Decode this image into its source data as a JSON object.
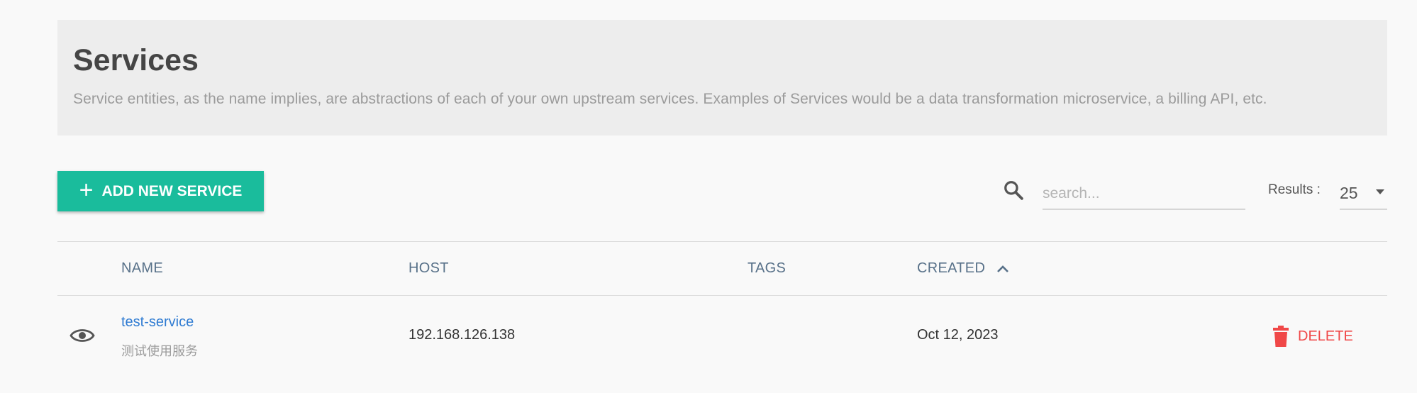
{
  "header": {
    "title": "Services",
    "description": "Service entities, as the name implies, are abstractions of each of your own upstream services. Examples of Services would be a data transformation microservice, a billing API, etc."
  },
  "toolbar": {
    "add_button_icon": "plus-icon",
    "add_button_label": "ADD NEW SERVICE",
    "search_icon": "search-icon",
    "search_placeholder": "search...",
    "search_value": "",
    "results_label": "Results :",
    "results_value": "25"
  },
  "table": {
    "columns": [
      "NAME",
      "HOST",
      "TAGS",
      "CREATED"
    ],
    "sort_icon": "chevron-up-icon",
    "rows": [
      {
        "name": "test-service",
        "description": "测试使用服务",
        "host": "192.168.126.138",
        "tags": "",
        "created": "Oct 12, 2023",
        "delete_label": "DELETE"
      }
    ]
  },
  "colors": {
    "accent": "#1abc9c",
    "link": "#2e7bd2",
    "danger": "#f04848",
    "header_bg": "#ededed",
    "column_header": "#587189"
  }
}
